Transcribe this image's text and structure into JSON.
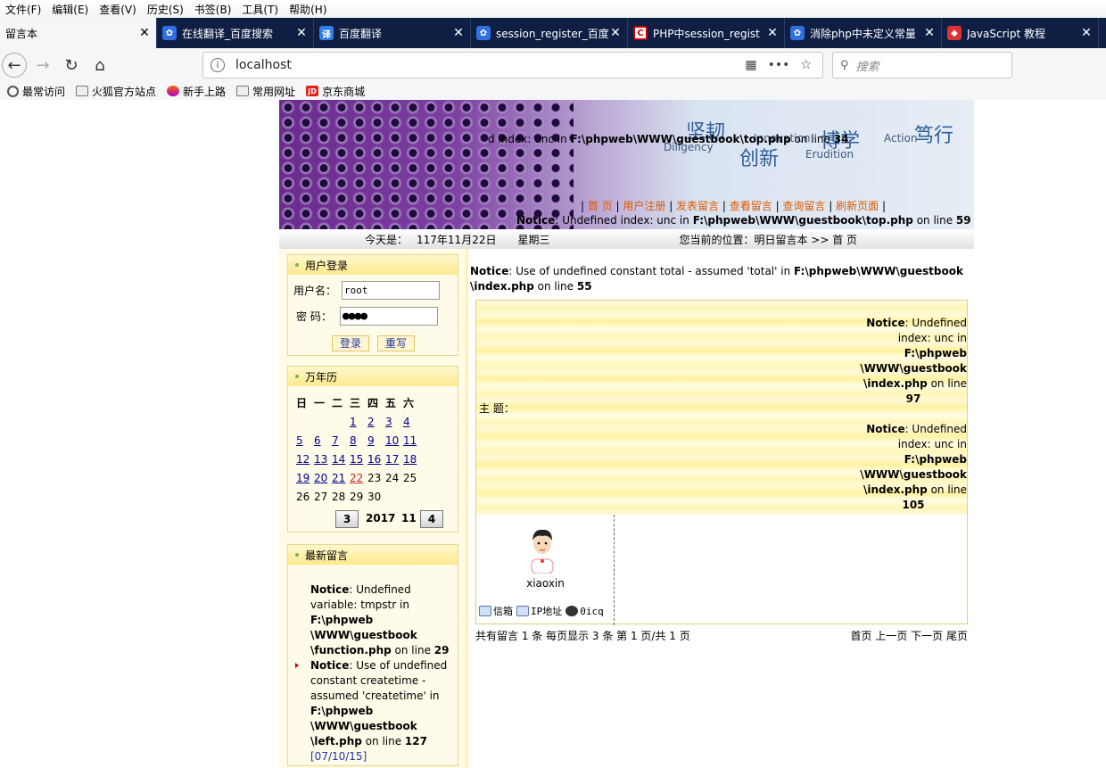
{
  "menu": [
    "文件(F)",
    "编辑(E)",
    "查看(V)",
    "历史(S)",
    "书签(B)",
    "工具(T)",
    "帮助(H)"
  ],
  "tabs": [
    {
      "title": "留言本",
      "icon": "none",
      "active": true
    },
    {
      "title": "在线翻译_百度搜索",
      "icon": "baidu-icon",
      "active": false
    },
    {
      "title": "百度翻译",
      "icon": "baidu-translate-icon",
      "active": false
    },
    {
      "title": "session_register_百度",
      "icon": "baidu-icon",
      "active": false
    },
    {
      "title": "PHP中session_regist",
      "icon": "csdn-icon",
      "active": false
    },
    {
      "title": "消除php中未定义常量",
      "icon": "baidu-icon",
      "active": false
    },
    {
      "title": "JavaScript 教程",
      "icon": "runoob-icon",
      "active": false
    }
  ],
  "address": {
    "url": "localhost",
    "search_placeholder": "搜索"
  },
  "bookmarks": [
    "最常访问",
    "火狐官方站点",
    "新手上路",
    "常用网址",
    "京东商城"
  ],
  "banner": {
    "words": [
      "坚韧",
      "Diligency",
      "Innovation",
      "创新",
      "博学",
      "Erudition",
      "Action",
      "笃行"
    ],
    "notice1_pre": "d index: unc in ",
    "notice1_path": "F:\\phpweb\\WWW\\guestbook\\top.php",
    "notice1_post": " on line ",
    "notice1_line": "34",
    "nav": [
      "首 页",
      "用户注册",
      "发表留言",
      "查看留言",
      "查询留言",
      "刷新页面"
    ],
    "notice2_label": "Notice",
    "notice2_text": ": Undefined index: unc in ",
    "notice2_path": "F:\\phpweb\\WWW\\guestbook\\top.php",
    "notice2_post": " on line ",
    "notice2_line": "59"
  },
  "datebar": {
    "today_label": "今天是：",
    "date": "117年11月22日",
    "weekday": "星期三",
    "location": "您当前的位置：明日留言本 >> 首 页"
  },
  "login": {
    "title": "用户登录",
    "user_label": "用户名：",
    "user_value": "root",
    "pass_label": "密 码：",
    "pass_value": "●●●●",
    "login_btn": "登录",
    "reset_btn": "重写"
  },
  "calendar": {
    "title": "万年历",
    "weekdays": [
      "日",
      "一",
      "二",
      "三",
      "四",
      "五",
      "六"
    ],
    "weeks": [
      [
        "",
        "",
        "",
        "1",
        "2",
        "3",
        "4"
      ],
      [
        "5",
        "6",
        "7",
        "",
        "8",
        "9",
        "10",
        "11"
      ],
      [
        "12",
        "13",
        "14",
        "",
        "15",
        "16",
        "17",
        "18"
      ],
      [
        "19",
        "20",
        "21",
        "",
        "22",
        "23",
        "24",
        "25"
      ],
      [
        "26",
        "27",
        "28",
        "",
        "29",
        "30"
      ]
    ],
    "prev": "3",
    "year": "2017",
    "month": "11",
    "next": "4"
  },
  "latest": {
    "title": "最新留言",
    "n1_label": "Notice",
    "n1_text": ": Undefined variable: tmpstr in ",
    "n1_path": "F:\\phpweb \\WWW\\guestbook \\function.php",
    "n1_post": " on line ",
    "n1_line": "29",
    "n2_label": "Notice",
    "n2_text": ": Use of undefined constant createtime - assumed 'createtime' in ",
    "n2_path": "F:\\phpweb \\WWW\\guestbook \\left.php",
    "n2_post": " on line ",
    "n2_line": "127",
    "n2_date": "[07/10/15]"
  },
  "main": {
    "notice_label": "Notice",
    "notice_text": ": Use of undefined constant total - assumed 'total' in ",
    "notice_path": "F:\\phpweb\\WWW\\guestbook \\index.php",
    "notice_post": " on line ",
    "notice_line": "55",
    "subject_label": "主 题：",
    "r1_label": "Notice",
    "r1_text": ": Undefined index: unc in",
    "r1_path": "F:\\phpweb \\WWW\\guestbook \\index.php",
    "r1_post": " on line",
    "r1_line": "97",
    "r2_label": "Notice",
    "r2_text": ": Undefined index: unc in",
    "r2_path": "F:\\phpweb \\WWW\\guestbook \\index.php",
    "r2_post": " on line",
    "r2_line": "105",
    "username": "xiaoxin",
    "icons": [
      "信箱",
      "IP地址",
      "0icq"
    ],
    "pager_left": "共有留言 1 条 每页显示 3 条 第 1 页/共 1 页",
    "pager_right": "首页 上一页 下一页 尾页"
  }
}
